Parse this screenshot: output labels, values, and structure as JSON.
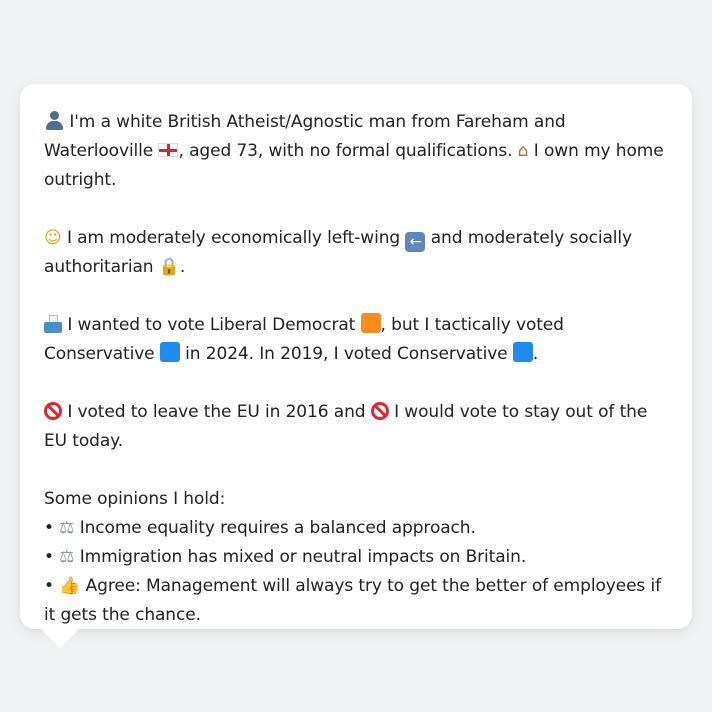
{
  "profile_card": {
    "line_intro_a": "I'm a white British Atheist/Agnostic man from Fareham and Waterlooville",
    "line_intro_b": ", aged 73, with no formal qualifications.",
    "line_intro_c": "I own my home outright.",
    "politics_a": "I am moderately economically left-wing",
    "politics_b": "and moderately socially authoritarian",
    "politics_c": ".",
    "vote_a": "I wanted to vote Liberal Democrat",
    "vote_b": ", but I tactically voted Conservative",
    "vote_c": "in 2024. In 2019, I voted Conservative",
    "vote_d": ".",
    "eu_a": "I voted to leave the EU in 2016 and",
    "eu_b": "I would vote to stay out of the EU today.",
    "opinions_heading": "Some opinions I hold:",
    "opinions": [
      {
        "bullet": "•",
        "text": "Income equality requires a balanced approach."
      },
      {
        "bullet": "•",
        "text": "Immigration has mixed or neutral impacts on Britain."
      },
      {
        "bullet": "•",
        "text": "Agree: Management will always try to get the better of employees if it gets the chance."
      }
    ],
    "icons": {
      "person": "person-icon",
      "flag": "england-flag-icon",
      "house": "house-icon",
      "thinking": "thinking-face-icon",
      "left_arrow": "left-arrow-icon",
      "lock": "lock-icon",
      "ballot": "ballot-box-icon",
      "orange_square": "orange-square-icon",
      "blue_square": "blue-square-icon",
      "no_entry": "no-entry-icon",
      "scales": "scales-icon",
      "thumbs_up": "thumbs-up-icon"
    },
    "colors": {
      "liberal_democrat": "#ff8c1a",
      "conservative": "#1d8bf1",
      "card_background": "#ffffff",
      "page_background": "#f1f2f4"
    }
  }
}
